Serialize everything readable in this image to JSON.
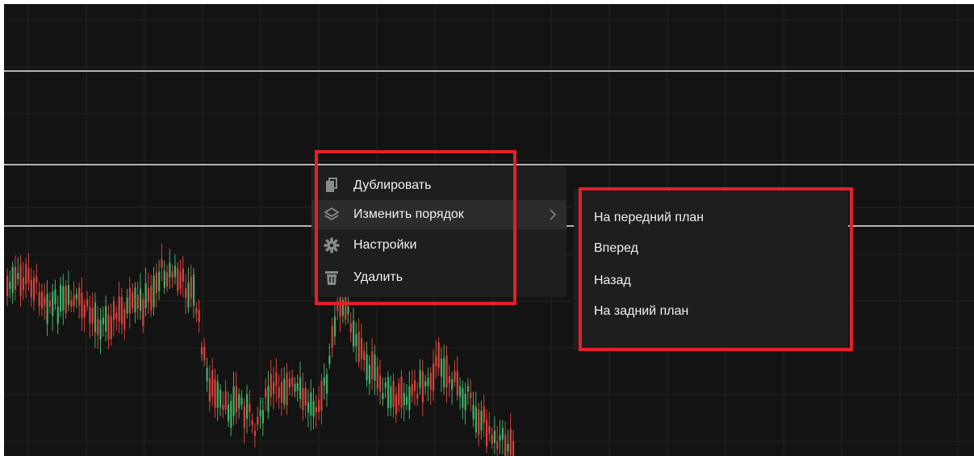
{
  "context_menu": {
    "items": [
      {
        "label": "Дублировать",
        "icon": "copy-icon"
      },
      {
        "label": "Изменить порядок",
        "icon": "layers-icon",
        "has_submenu": true
      },
      {
        "label": "Настройки",
        "icon": "gear-icon"
      },
      {
        "label": "Удалить",
        "icon": "trash-icon"
      }
    ]
  },
  "submenu": {
    "items": [
      {
        "label": "На передний план"
      },
      {
        "label": "Вперед"
      },
      {
        "label": "Назад"
      },
      {
        "label": "На задний план"
      }
    ]
  },
  "colors": {
    "background": "#131313",
    "menu_background": "#1e1e1e",
    "menu_hover": "#2c2c2c",
    "grid": "#232323",
    "level_line": "#b5b5b5",
    "candle_up": "#3fb068",
    "candle_down": "#d8413b",
    "highlight": "#e3202b"
  }
}
